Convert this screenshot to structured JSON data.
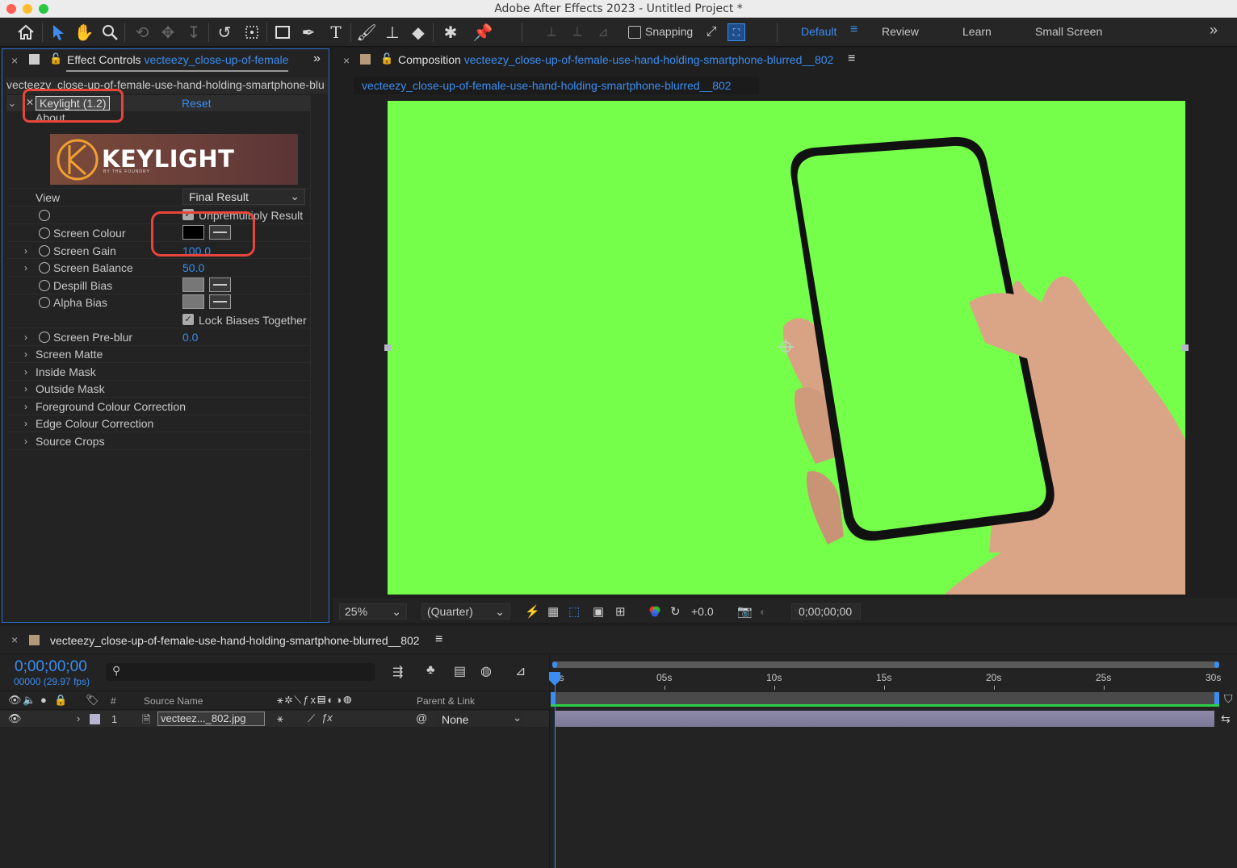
{
  "window": {
    "title": "Adobe After Effects 2023 - Untitled Project *"
  },
  "toolbar": {
    "snapping_label": "Snapping",
    "workspaces": [
      "Default",
      "Review",
      "Learn",
      "Small Screen"
    ],
    "more_label": "»"
  },
  "effect_controls": {
    "tab_label": "Effect Controls",
    "tab_layer": "vecteezy_close-up-of-female",
    "layer_path": "vecteezy_close-up-of-female-use-hand-holding-smartphone-blu",
    "effect_name": "Keylight (1.2)",
    "reset_label": "Reset",
    "about_label": "About",
    "logo_text": "KEYLIGHT",
    "logo_sub": "BY THE FOUNDRY",
    "view_label": "View",
    "view_value": "Final Result",
    "unpremultiply_label": "Unpremultiply Result",
    "screen_colour_label": "Screen Colour",
    "screen_gain_label": "Screen Gain",
    "screen_gain_value": "100.0",
    "screen_balance_label": "Screen Balance",
    "screen_balance_value": "50.0",
    "despill_bias_label": "Despill Bias",
    "alpha_bias_label": "Alpha Bias",
    "lock_biases_label": "Lock Biases Together",
    "screen_preblur_label": "Screen Pre-blur",
    "screen_preblur_value": "0.0",
    "groups": [
      "Screen Matte",
      "Inside Mask",
      "Outside Mask",
      "Foreground Colour Correction",
      "Edge Colour Correction",
      "Source Crops"
    ],
    "screen_colour_hex": "#000000"
  },
  "composition": {
    "tab_label": "Composition",
    "tab_name": "vecteezy_close-up-of-female-use-hand-holding-smartphone-blurred__802",
    "subtab": "vecteezy_close-up-of-female-use-hand-holding-smartphone-blurred__802",
    "zoom": "25%",
    "resolution": "(Quarter)",
    "exposure": "+0.0",
    "timecode": "0;00;00;00",
    "bg_color": "#76ff4a"
  },
  "timeline": {
    "tab_name": "vecteezy_close-up-of-female-use-hand-holding-smartphone-blurred__802",
    "timecode": "0;00;00;00",
    "frame_info": "00000 (29.97 fps)",
    "col_hash": "#",
    "col_source": "Source Name",
    "col_parent": "Parent & Link",
    "ticks": [
      "0s",
      "05s",
      "10s",
      "15s",
      "20s",
      "25s",
      "30s"
    ],
    "layer": {
      "index": "1",
      "name": "vecteez..._802.jpg",
      "parent": "None"
    }
  }
}
